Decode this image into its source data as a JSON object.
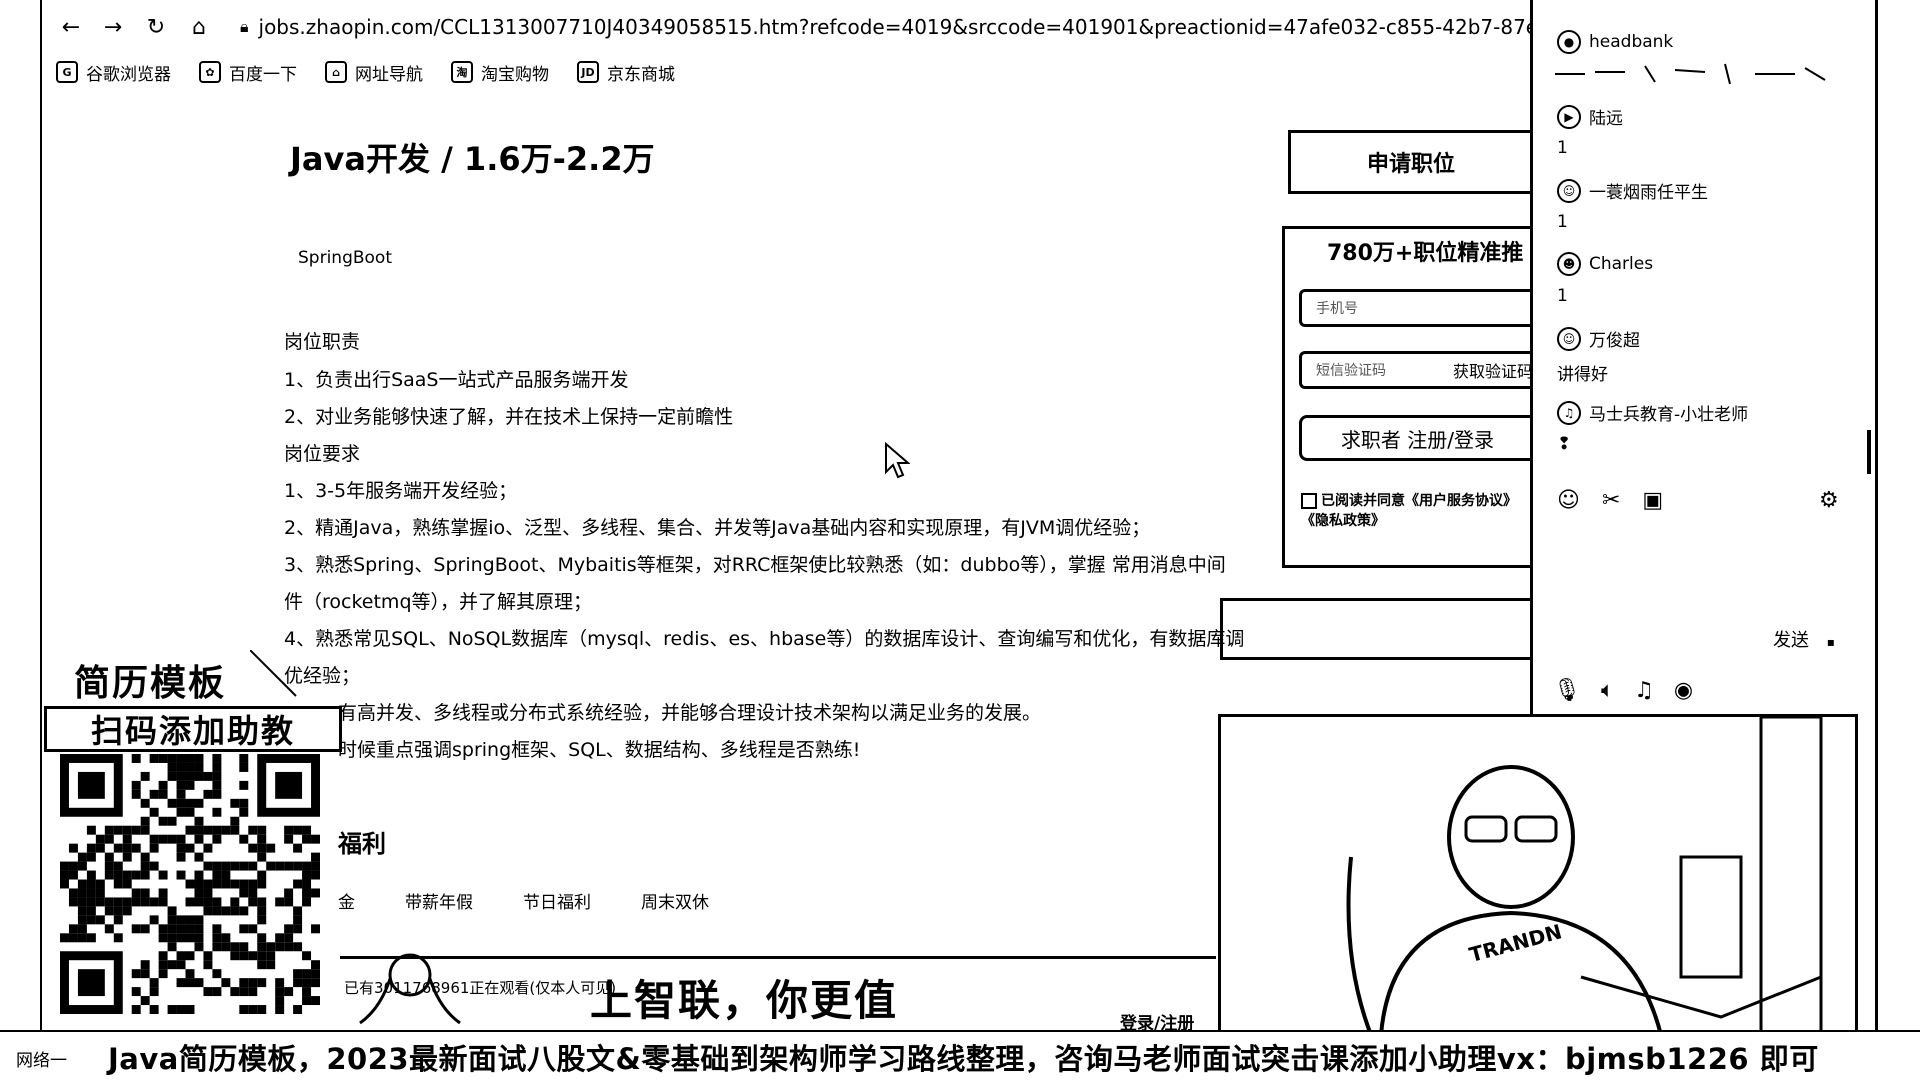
{
  "browser": {
    "back_icon": "arrow-left-icon",
    "url": "jobs.zhaopin.com/CCL1313007710J40349058515.htm?refcode=4019&srccode=401901&preactionid=47afe032-c855-42b7-87ee-81d7779ed0",
    "bookmarks": [
      {
        "icon": "G",
        "label": "谷歌浏览器"
      },
      {
        "icon": "✿",
        "label": "百度一下"
      },
      {
        "icon": "⌂",
        "label": "网址导航"
      },
      {
        "icon": "淘",
        "label": "淘宝购物"
      },
      {
        "icon": "JD",
        "label": "京东商城"
      }
    ]
  },
  "job": {
    "title": "Java开发 / 1.6万-2.2万",
    "tag": "SpringBoot",
    "lines": [
      "岗位职责",
      "1、负责出行SaaS一站式产品服务端开发",
      "2、对业务能够快速了解，并在技术上保持一定前瞻性",
      "岗位要求",
      "1、3-5年服务端开发经验；",
      "2、精通Java，熟练掌握io、泛型、多线程、集合、并发等Java基础内容和实现原理，有JVM调优经验；",
      "3、熟悉Spring、SpringBoot、Mybaitis等框架，对RRC框架使比较熟悉（如：dubbo等），掌握 常用消息中间",
      "件（rocketmq等），并了解其原理；",
      "4、熟悉常见SQL、NoSQL数据库（mysql、redis、es、hbase等）的数据库设计、查询编写和优化，有数据库调",
      "优经验；",
      "有高并发、多线程或分布式系统经验，并能够合理设计技术架构以满足业务的发展。",
      "时候重点强调spring框架、SQL、数据结构、多线程是否熟练!"
    ],
    "benefit_title": "福利",
    "benefits": [
      "金",
      "带薪年假",
      "节日福利",
      "周末双休"
    ]
  },
  "apply": {
    "apply_button": "申请职位",
    "reg_title": "780万+职位精准推",
    "phone_placeholder": "手机号",
    "code_placeholder": "短信验证码",
    "get_code": "获取验证码",
    "login_button": "求职者 注册/登录",
    "agreement": "已阅读并同意《用户服务协议》《隐私政策》"
  },
  "chat": {
    "messages": [
      {
        "user": "headbank",
        "text": ""
      },
      {
        "user": "陆远",
        "text": "1"
      },
      {
        "user": "一蓑烟雨任平生",
        "text": "1"
      },
      {
        "user": "Charles",
        "text": "1"
      },
      {
        "user": "万俊超",
        "text": "讲得好"
      },
      {
        "user": "马士兵教育-小壮老师",
        "text": "❢"
      }
    ],
    "send_label": "发送"
  },
  "promo": {
    "title": "简历模板",
    "subtitle": "扫码添加助教"
  },
  "site": {
    "slogan": "上智联，你更值",
    "viewers": "已有3011768961正在观看(仅本人可见)",
    "login": "登录/注册"
  },
  "banner": {
    "left": "网络一",
    "text": "Java简历模板，2023最新面试八股文&零基础到架构师学习路线整理，咨询马老师面试突击课添加小助理vx：bjmsb1226 即可"
  }
}
